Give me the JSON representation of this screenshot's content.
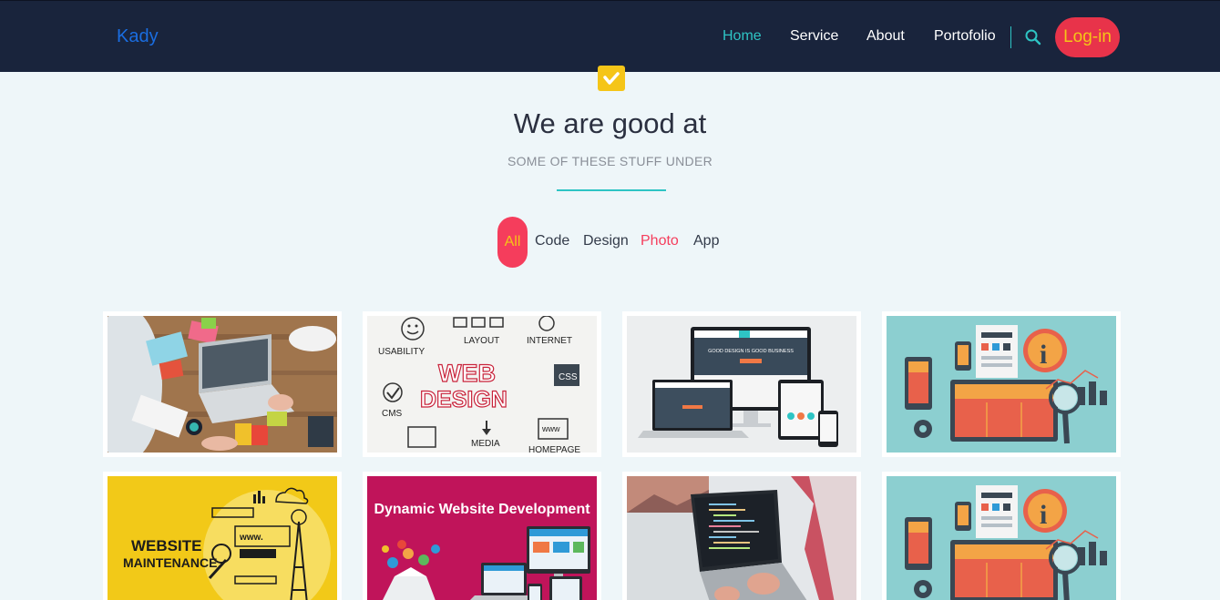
{
  "nav": {
    "brand": "Kady",
    "links": [
      "Home",
      "Service",
      "About",
      "Portofolio"
    ],
    "login": "Log-in"
  },
  "section": {
    "title": "We are good at",
    "subtitle": "SOME OF THESE STUFF UNDER"
  },
  "filters": [
    "All",
    "Code",
    "Design",
    "Photo",
    "App"
  ],
  "portfolio": {
    "web_design": {
      "usability": "USABILITY",
      "layout": "LAYOUT",
      "internet": "INTERNET",
      "web": "WEB",
      "design": "DESIGN",
      "css": "CSS",
      "cms": "CMS",
      "www": "www",
      "media": "MEDIA",
      "homepage": "HOMEPAGE"
    },
    "responsive": {
      "headline": "GOOD DESIGN IS GOOD BUSINESS"
    },
    "maintenance": {
      "line1": "WEBSITE",
      "line2": "MAINTENANCE",
      "www": "www."
    },
    "dynamic": {
      "title": "Dynamic Website Development"
    }
  },
  "colors": {
    "navbar": "#19243c",
    "accent": "#2ec4c4",
    "login_bg": "#e8334a",
    "login_text": "#f5c518",
    "filter_active": "#f53d5c",
    "page_bg": "#eef6f9"
  }
}
